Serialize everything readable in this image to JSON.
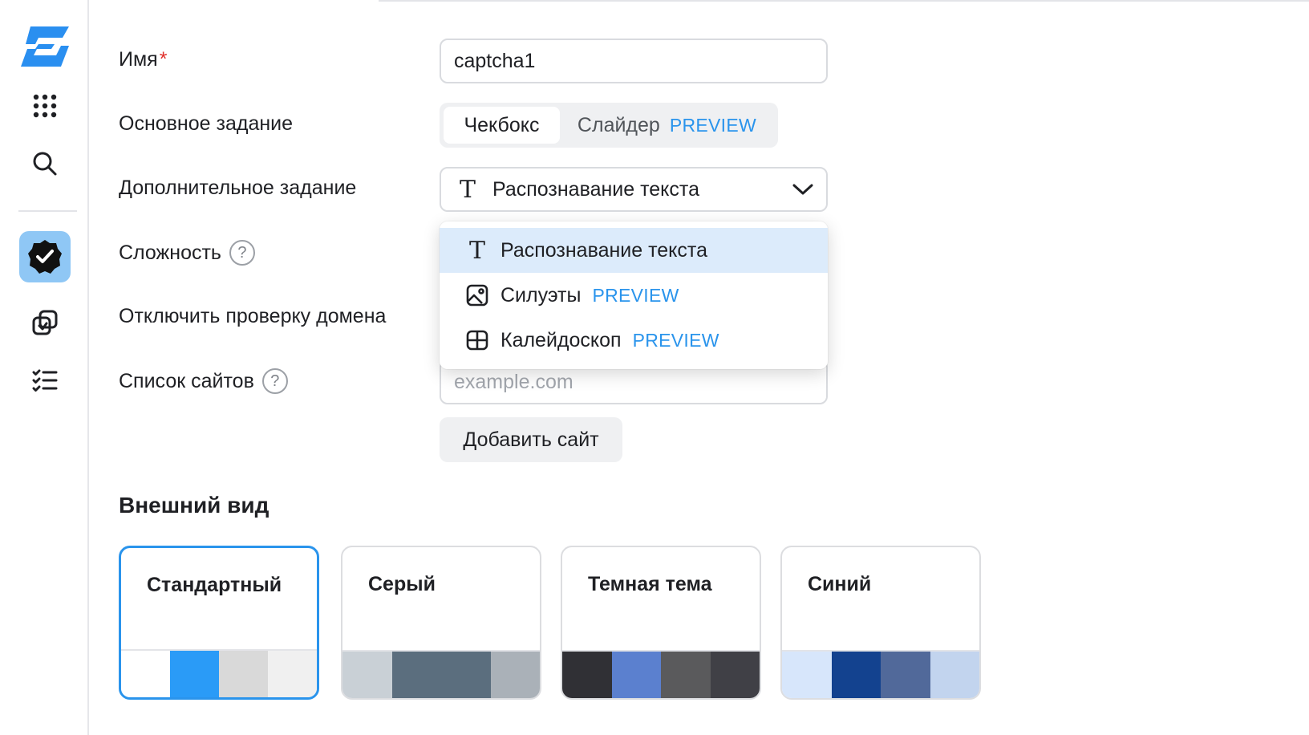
{
  "sidebar": {
    "items": [
      {
        "icon": "brand-logo-icon"
      },
      {
        "icon": "apps-grid-icon"
      },
      {
        "icon": "search-icon"
      },
      {
        "icon": "captcha-checkbox-icon",
        "active": true
      },
      {
        "icon": "copy-shapes-icon"
      },
      {
        "icon": "checklist-icon"
      }
    ]
  },
  "form": {
    "name": {
      "label": "Имя",
      "required_mark": "*",
      "value": "captcha1"
    },
    "main_task": {
      "label": "Основное задание",
      "options": [
        {
          "label": "Чекбокс",
          "badge": "",
          "active": true
        },
        {
          "label": "Слайдер",
          "badge": "PREVIEW",
          "active": false
        }
      ]
    },
    "extra_task": {
      "label": "Дополнительное задание",
      "selected_icon": "text-t-icon",
      "selected": "Распознавание текста",
      "dropdown": [
        {
          "icon": "text-t-icon",
          "label": "Распознавание текста",
          "badge": "",
          "selected": true
        },
        {
          "icon": "image-icon",
          "label": "Силуэты",
          "badge": "PREVIEW",
          "selected": false
        },
        {
          "icon": "grid-icon",
          "label": "Калейдоскоп",
          "badge": "PREVIEW",
          "selected": false
        }
      ]
    },
    "complexity": {
      "label": "Сложность",
      "help": "?"
    },
    "disable_domain_check": {
      "label": "Отключить проверку домена"
    },
    "sites": {
      "label": "Список сайтов",
      "help": "?",
      "placeholder": "example.com",
      "add_button": "Добавить сайт"
    }
  },
  "appearance": {
    "title": "Внешний вид",
    "themes": [
      {
        "name": "Стандартный",
        "selected": true,
        "colors": [
          "#ffffff",
          "#2a9bf7",
          "#d9d9d9",
          "#f0f0f0"
        ]
      },
      {
        "name": "Серый",
        "selected": false,
        "colors": [
          "#c9d0d6",
          "#5b6e7e",
          "#5b6e7e",
          "#aab1b8"
        ]
      },
      {
        "name": "Темная тема",
        "selected": false,
        "colors": [
          "#303035",
          "#5b80cf",
          "#5a5a5c",
          "#404046"
        ]
      },
      {
        "name": "Синий",
        "selected": false,
        "colors": [
          "#d7e6fb",
          "#13428f",
          "#51699a",
          "#c2d4ee"
        ]
      }
    ]
  }
}
